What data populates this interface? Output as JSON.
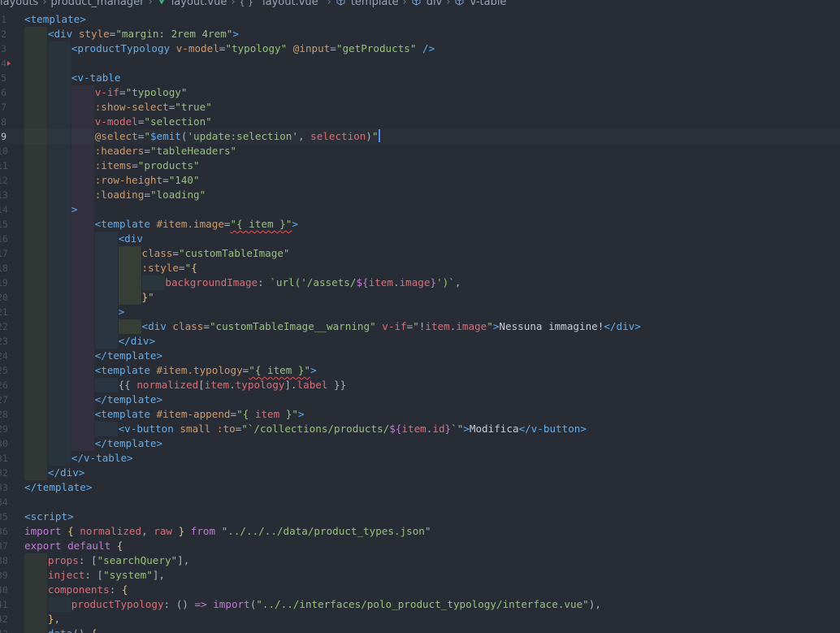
{
  "breadcrumb": {
    "items": [
      {
        "label": "layouts",
        "icon": "chevron-right-icon"
      },
      {
        "label": "product_manager",
        "icon": "chevron-right-icon"
      },
      {
        "label": "layout.vue",
        "icon": "vue-icon",
        "accent": "#41b883"
      },
      {
        "label": "\"layout.vue\"",
        "icon": "braces-icon"
      },
      {
        "label": "template",
        "icon": "cube-icon"
      },
      {
        "label": "div",
        "icon": "cube-icon"
      },
      {
        "label": "v-table",
        "icon": "cube-icon"
      }
    ]
  },
  "editor": {
    "cursor_line": 9,
    "theme": {
      "background": "#272c35",
      "tag": "#61afef",
      "attribute": "#d19a66",
      "string": "#98c379",
      "keyword": "#c678dd",
      "error_underline": "#e05252",
      "cursor": "#528bff"
    },
    "lines": [
      {
        "n": "1",
        "depth": 0,
        "tokens": [
          [
            "tag",
            "<template>"
          ]
        ]
      },
      {
        "n": "2",
        "depth": 1,
        "tokens": [
          [
            "tag",
            "<div "
          ],
          [
            "attr",
            "style"
          ],
          [
            "punc",
            "="
          ],
          [
            "str",
            "\"margin: 2rem 4rem\""
          ],
          [
            "tag",
            ">"
          ]
        ]
      },
      {
        "n": "3",
        "depth": 2,
        "tokens": [
          [
            "tag",
            "<productTypology "
          ],
          [
            "attr",
            "v-model"
          ],
          [
            "punc",
            "="
          ],
          [
            "str",
            "\"typology\" "
          ],
          [
            "attr",
            "@input"
          ],
          [
            "punc",
            "="
          ],
          [
            "str",
            "\"getProducts\""
          ],
          [
            "tag",
            " />"
          ]
        ]
      },
      {
        "n": "4",
        "depth": 2,
        "tokens": []
      },
      {
        "n": "5",
        "depth": 2,
        "tokens": [
          [
            "tag",
            "<v-table"
          ]
        ]
      },
      {
        "n": "6",
        "depth": 3,
        "tokens": [
          [
            "dir",
            "v-if"
          ],
          [
            "punc",
            "="
          ],
          [
            "str",
            "\"typology\""
          ]
        ]
      },
      {
        "n": "7",
        "depth": 3,
        "tokens": [
          [
            "attr",
            ":show-select"
          ],
          [
            "punc",
            "="
          ],
          [
            "str",
            "\"true\""
          ]
        ]
      },
      {
        "n": "8",
        "depth": 3,
        "tokens": [
          [
            "dir",
            "v-model"
          ],
          [
            "punc",
            "="
          ],
          [
            "str",
            "\"selection\""
          ]
        ]
      },
      {
        "n": "9",
        "depth": 3,
        "tokens": [
          [
            "attr",
            "@select"
          ],
          [
            "punc",
            "="
          ],
          [
            "str",
            "\""
          ],
          [
            "fn",
            "$emit"
          ],
          [
            "punc",
            "("
          ],
          [
            "str",
            "'update:selection'"
          ],
          [
            "punc",
            ", "
          ],
          [
            "var",
            "selection"
          ],
          [
            "punc",
            ")"
          ],
          [
            "str",
            "\""
          ],
          [
            "cursor",
            ""
          ]
        ]
      },
      {
        "n": "10",
        "depth": 3,
        "tokens": [
          [
            "attr",
            ":headers"
          ],
          [
            "punc",
            "="
          ],
          [
            "str",
            "\"tableHeaders\""
          ]
        ]
      },
      {
        "n": "11",
        "depth": 3,
        "tokens": [
          [
            "attr",
            ":items"
          ],
          [
            "punc",
            "="
          ],
          [
            "str",
            "\"products\""
          ]
        ]
      },
      {
        "n": "12",
        "depth": 3,
        "tokens": [
          [
            "attr",
            ":row-height"
          ],
          [
            "punc",
            "="
          ],
          [
            "str",
            "\"140\""
          ]
        ]
      },
      {
        "n": "13",
        "depth": 3,
        "tokens": [
          [
            "attr",
            ":loading"
          ],
          [
            "punc",
            "="
          ],
          [
            "str",
            "\"loading\""
          ]
        ]
      },
      {
        "n": "14",
        "depth": 3,
        "tokens": [
          [
            "tag",
            ">"
          ]
        ],
        "outdent": true
      },
      {
        "n": "15",
        "depth": 3,
        "tokens": [
          [
            "tag",
            "<template "
          ],
          [
            "attr",
            "#item.image"
          ],
          [
            "punc",
            "="
          ],
          [
            "squig",
            "\"{ item }\""
          ],
          [
            "tag",
            ">"
          ]
        ]
      },
      {
        "n": "16",
        "depth": 4,
        "tokens": [
          [
            "tag",
            "<div"
          ]
        ]
      },
      {
        "n": "17",
        "depth": 5,
        "tokens": [
          [
            "attr",
            "class"
          ],
          [
            "punc",
            "="
          ],
          [
            "str",
            "\"customTableImage\""
          ]
        ]
      },
      {
        "n": "18",
        "depth": 5,
        "tokens": [
          [
            "attr",
            ":style"
          ],
          [
            "punc",
            "="
          ],
          [
            "str",
            "\""
          ],
          [
            "yel",
            "{"
          ]
        ]
      },
      {
        "n": "19",
        "depth": 6,
        "tokens": [
          [
            "prop",
            "backgroundImage"
          ],
          [
            "punc",
            ": "
          ],
          [
            "str",
            "`url('/assets/"
          ],
          [
            "kw",
            "${"
          ],
          [
            "var",
            "item"
          ],
          [
            "punc",
            "."
          ],
          [
            "var",
            "image"
          ],
          [
            "kw",
            "}"
          ],
          [
            "str",
            "')`"
          ],
          [
            "punc",
            ","
          ]
        ]
      },
      {
        "n": "20",
        "depth": 5,
        "tokens": [
          [
            "yel",
            "}"
          ],
          [
            "str",
            "\""
          ]
        ]
      },
      {
        "n": "21",
        "depth": 4,
        "tokens": [
          [
            "tag",
            ">"
          ]
        ]
      },
      {
        "n": "22",
        "depth": 5,
        "tokens": [
          [
            "tag",
            "<div "
          ],
          [
            "attr",
            "class"
          ],
          [
            "punc",
            "="
          ],
          [
            "str",
            "\"customTableImage__warning\" "
          ],
          [
            "dir",
            "v-if"
          ],
          [
            "punc",
            "="
          ],
          [
            "str",
            "\""
          ],
          [
            "punc",
            "!"
          ],
          [
            "var",
            "item"
          ],
          [
            "punc",
            "."
          ],
          [
            "var",
            "image"
          ],
          [
            "str",
            "\""
          ],
          [
            "tag",
            ">"
          ],
          [
            "text",
            "Nessuna immagine!"
          ],
          [
            "tag",
            "</div>"
          ]
        ]
      },
      {
        "n": "23",
        "depth": 4,
        "tokens": [
          [
            "tag",
            "</div>"
          ]
        ]
      },
      {
        "n": "24",
        "depth": 3,
        "tokens": [
          [
            "tag",
            "</template>"
          ]
        ]
      },
      {
        "n": "25",
        "depth": 3,
        "tokens": [
          [
            "tag",
            "<template "
          ],
          [
            "attr",
            "#item.typology"
          ],
          [
            "punc",
            "="
          ],
          [
            "squig",
            "\"{ item }\""
          ],
          [
            "tag",
            ">"
          ]
        ]
      },
      {
        "n": "26",
        "depth": 4,
        "tokens": [
          [
            "punc",
            "{{ "
          ],
          [
            "var",
            "normalized"
          ],
          [
            "punc",
            "["
          ],
          [
            "var",
            "item"
          ],
          [
            "punc",
            "."
          ],
          [
            "var",
            "typology"
          ],
          [
            "punc",
            "]."
          ],
          [
            "var",
            "label"
          ],
          [
            "punc",
            " }}"
          ]
        ]
      },
      {
        "n": "27",
        "depth": 3,
        "tokens": [
          [
            "tag",
            "</template>"
          ]
        ]
      },
      {
        "n": "28",
        "depth": 3,
        "tokens": [
          [
            "tag",
            "<template "
          ],
          [
            "attr",
            "#item-append"
          ],
          [
            "punc",
            "="
          ],
          [
            "str",
            "\"{ "
          ],
          [
            "var",
            "item"
          ],
          [
            "str",
            " }\""
          ],
          [
            "tag",
            ">"
          ]
        ]
      },
      {
        "n": "29",
        "depth": 4,
        "tokens": [
          [
            "tag",
            "<v-button "
          ],
          [
            "attr",
            "small "
          ],
          [
            "attr",
            ":to"
          ],
          [
            "punc",
            "="
          ],
          [
            "str",
            "\"`/collections/products/"
          ],
          [
            "kw",
            "${"
          ],
          [
            "var",
            "item"
          ],
          [
            "punc",
            "."
          ],
          [
            "var",
            "id"
          ],
          [
            "kw",
            "}"
          ],
          [
            "str",
            "`\""
          ],
          [
            "tag",
            ">"
          ],
          [
            "text",
            "Modifica"
          ],
          [
            "tag",
            "</v-button>"
          ]
        ]
      },
      {
        "n": "30",
        "depth": 3,
        "tokens": [
          [
            "tag",
            "</template>"
          ]
        ]
      },
      {
        "n": "31",
        "depth": 2,
        "tokens": [
          [
            "tag",
            "</v-table>"
          ]
        ]
      },
      {
        "n": "32",
        "depth": 1,
        "tokens": [
          [
            "tag",
            "</div>"
          ]
        ]
      },
      {
        "n": "33",
        "depth": 0,
        "tokens": [
          [
            "tag",
            "</template>"
          ]
        ]
      },
      {
        "n": "34",
        "depth": 0,
        "tokens": []
      },
      {
        "n": "35",
        "depth": 0,
        "tokens": [
          [
            "tag",
            "<script>"
          ]
        ]
      },
      {
        "n": "36",
        "depth": 0,
        "tokens": [
          [
            "kw",
            "import "
          ],
          [
            "yel",
            "{ "
          ],
          [
            "var",
            "normalized"
          ],
          [
            "punc",
            ", "
          ],
          [
            "var",
            "raw"
          ],
          [
            "yel",
            " } "
          ],
          [
            "kw",
            "from "
          ],
          [
            "str",
            "\"../../../data/product_types.json\""
          ]
        ]
      },
      {
        "n": "37",
        "depth": 0,
        "tokens": [
          [
            "kw",
            "export default "
          ],
          [
            "yel",
            "{"
          ]
        ]
      },
      {
        "n": "38",
        "depth": 1,
        "tokens": [
          [
            "prop",
            "props"
          ],
          [
            "punc",
            ": ["
          ],
          [
            "str",
            "\"searchQuery\""
          ],
          [
            "punc",
            "],"
          ]
        ]
      },
      {
        "n": "39",
        "depth": 1,
        "tokens": [
          [
            "prop",
            "inject"
          ],
          [
            "punc",
            ": ["
          ],
          [
            "str",
            "\"system\""
          ],
          [
            "punc",
            "],"
          ]
        ]
      },
      {
        "n": "40",
        "depth": 1,
        "tokens": [
          [
            "prop",
            "components"
          ],
          [
            "punc",
            ": "
          ],
          [
            "yel",
            "{"
          ]
        ]
      },
      {
        "n": "41",
        "depth": 2,
        "tokens": [
          [
            "prop",
            "productTypology"
          ],
          [
            "punc",
            ": () "
          ],
          [
            "kw",
            "=>"
          ],
          [
            "punc",
            " "
          ],
          [
            "kw",
            "import"
          ],
          [
            "punc",
            "("
          ],
          [
            "str",
            "\"../../interfaces/polo_product_typology/interface.vue\""
          ],
          [
            "punc",
            "),"
          ]
        ]
      },
      {
        "n": "42",
        "depth": 1,
        "tokens": [
          [
            "yel",
            "}"
          ],
          [
            "punc",
            ","
          ]
        ]
      },
      {
        "n": "43",
        "depth": 1,
        "tokens": [
          [
            "fn",
            "data"
          ],
          [
            "punc",
            "() "
          ],
          [
            "yel",
            "{"
          ]
        ]
      }
    ]
  }
}
